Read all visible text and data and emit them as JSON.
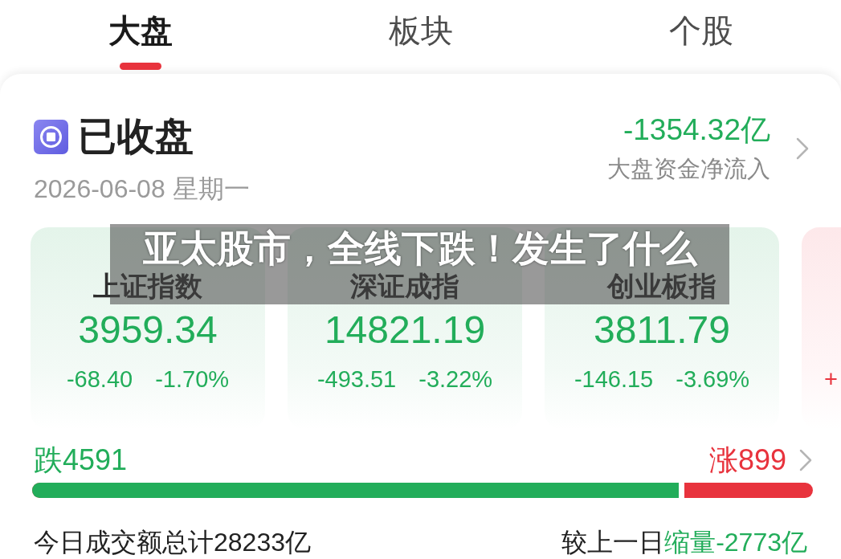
{
  "tabs": [
    {
      "label": "大盘",
      "selected": true
    },
    {
      "label": "板块",
      "selected": false
    },
    {
      "label": "个股",
      "selected": false
    }
  ],
  "market_status": {
    "label": "已收盘",
    "date": "2026-06-08 星期一"
  },
  "net_inflow": {
    "value": "-1354.32亿",
    "kind": "down",
    "label": "大盘资金净流入"
  },
  "index_cards": [
    {
      "name": "上证指数",
      "value": "3959.34",
      "change": "-68.40",
      "change_percent": "-1.70%",
      "kind": "down"
    },
    {
      "name": "深证成指",
      "value": "14821.19",
      "change": "-493.51",
      "change_percent": "-3.22%",
      "kind": "down"
    },
    {
      "name": "创业板指",
      "value": "3811.79",
      "change": "-146.15",
      "change_percent": "-3.69%",
      "kind": "down"
    },
    {
      "change": "+",
      "kind": "up"
    }
  ],
  "headline": "亚太股市，全线下跌！发生了什么",
  "breadth": {
    "decliners": "跌4591",
    "advancers": "涨899",
    "level": 0.835
  },
  "turnover": {
    "total": "今日成交额总计28233亿",
    "compare_label": "较上一日",
    "change": "缩量-2773亿",
    "kind": "down"
  }
}
